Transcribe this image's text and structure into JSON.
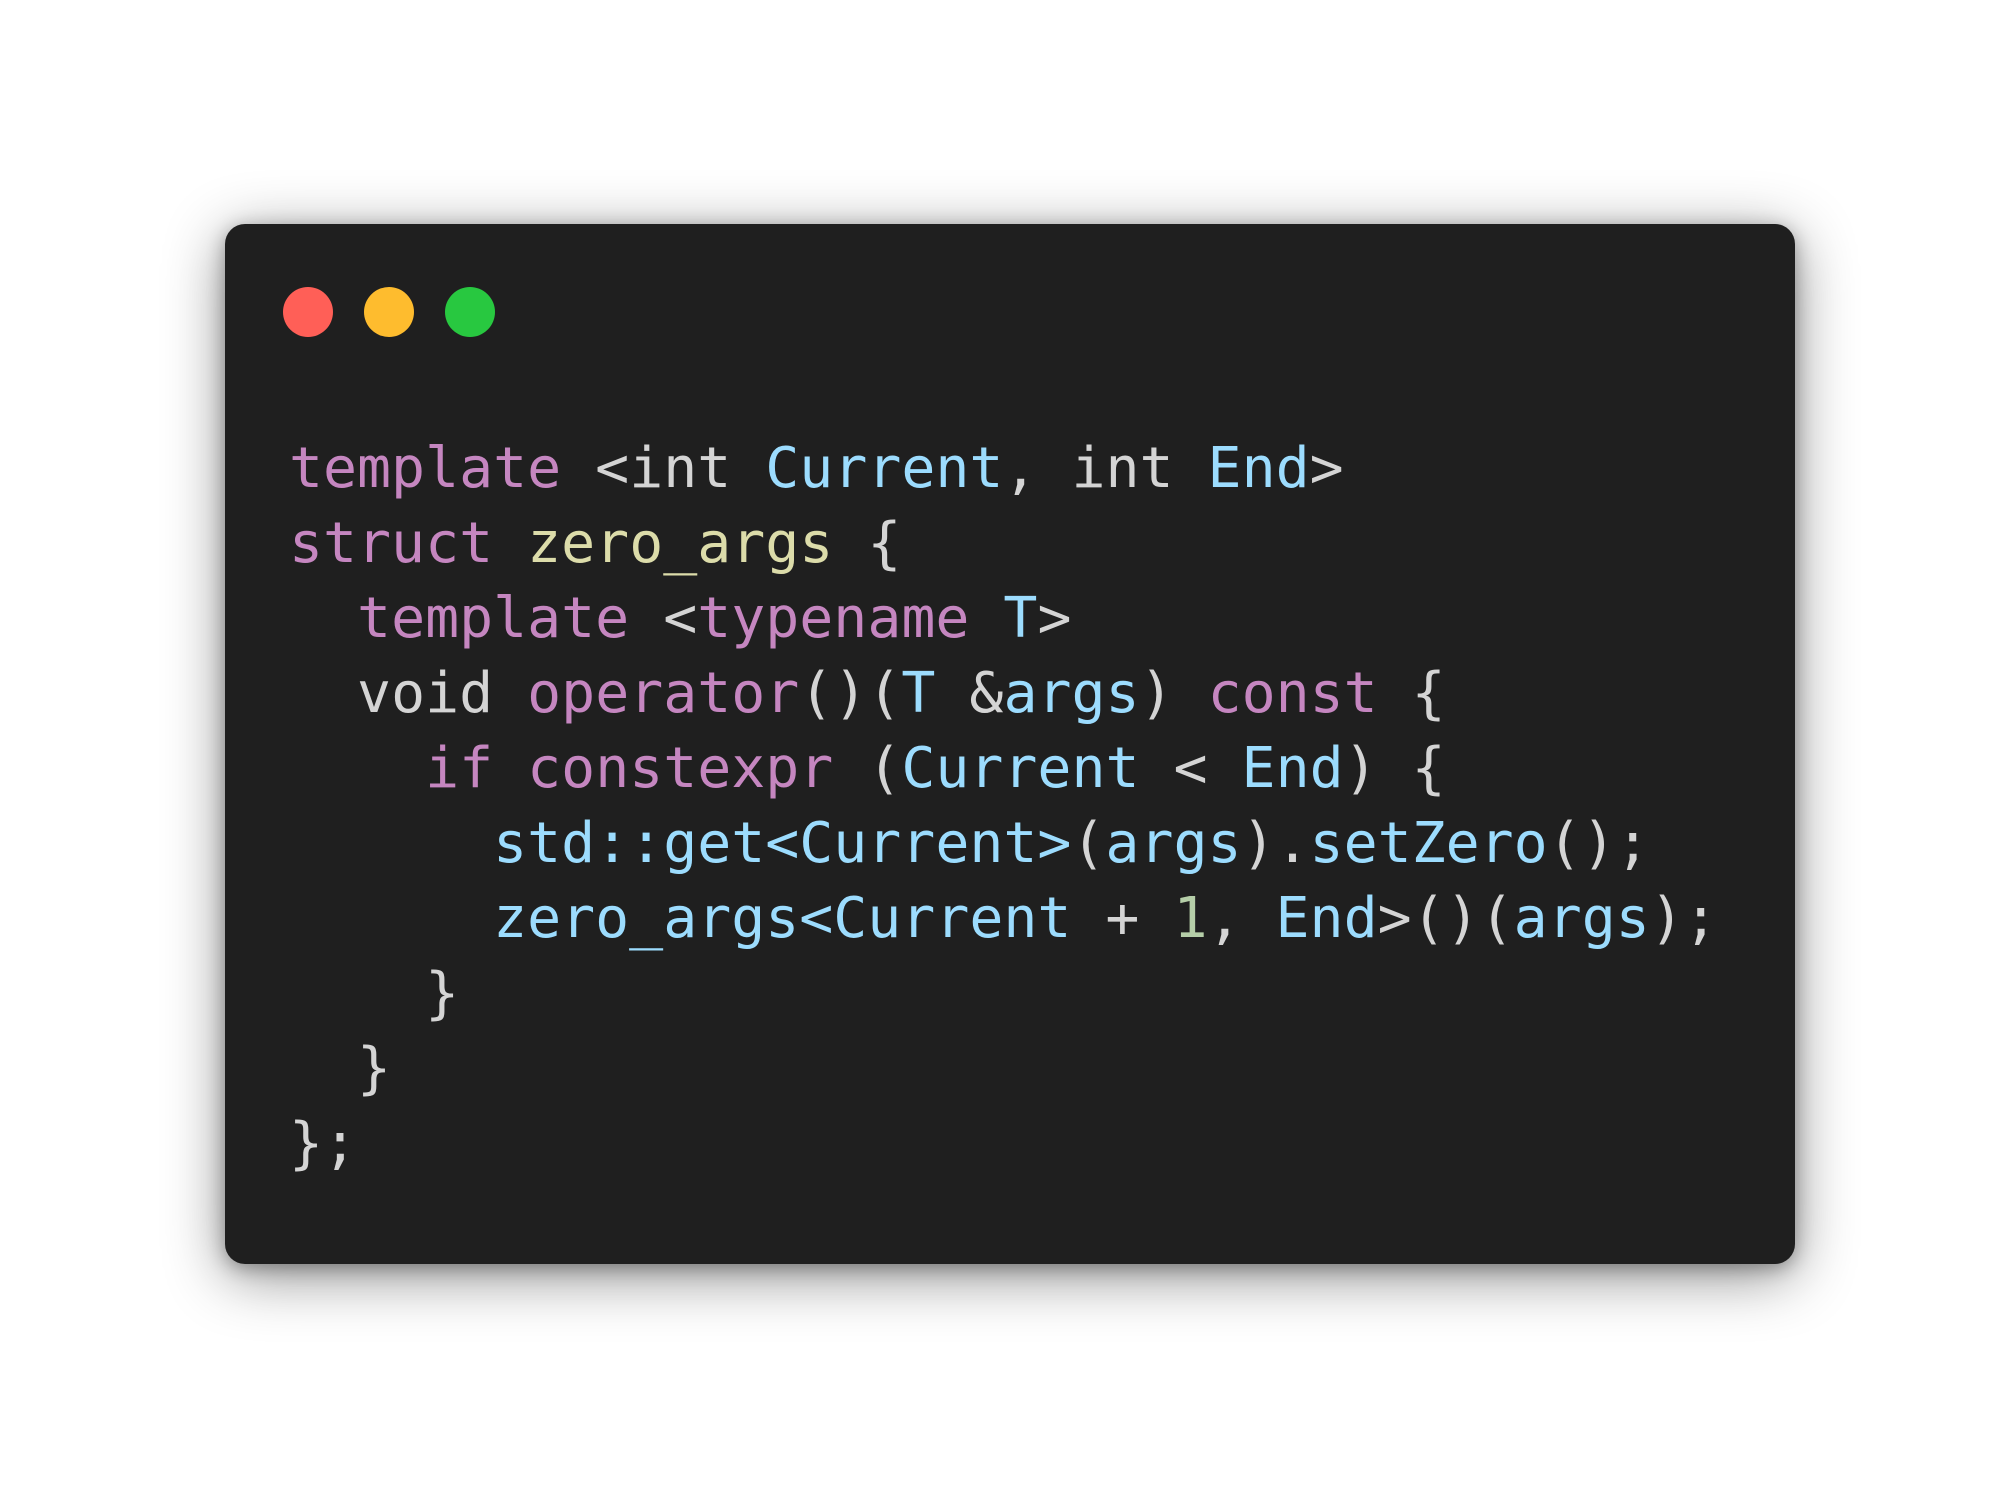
{
  "window": {
    "traffic_lights": [
      {
        "name": "close",
        "color": "#ff5f57"
      },
      {
        "name": "minimize",
        "color": "#febc2e"
      },
      {
        "name": "zoom",
        "color": "#28c840"
      }
    ]
  },
  "code": {
    "colors": {
      "keyword": "#c586c0",
      "type": "#d4d4d4",
      "param": "#9cdcfe",
      "function": "#9cdcfe",
      "identifier": "#dcdcaa",
      "number": "#b5cea8",
      "punctuation": "#d4d4d4",
      "background": "#1f1f1f"
    },
    "lines": [
      [
        {
          "t": "template",
          "c": "keyword"
        },
        {
          "t": " <",
          "c": "punct"
        },
        {
          "t": "int",
          "c": "type"
        },
        {
          "t": " ",
          "c": "punct"
        },
        {
          "t": "Current",
          "c": "param"
        },
        {
          "t": ", ",
          "c": "punct"
        },
        {
          "t": "int",
          "c": "type"
        },
        {
          "t": " ",
          "c": "punct"
        },
        {
          "t": "End",
          "c": "param"
        },
        {
          "t": ">",
          "c": "punct"
        }
      ],
      [
        {
          "t": "struct",
          "c": "keyword"
        },
        {
          "t": " ",
          "c": "punct"
        },
        {
          "t": "zero_args",
          "c": "ident"
        },
        {
          "t": " {",
          "c": "punct"
        }
      ],
      [
        {
          "t": "  ",
          "c": "punct"
        },
        {
          "t": "template",
          "c": "keyword"
        },
        {
          "t": " <",
          "c": "punct"
        },
        {
          "t": "typename",
          "c": "keyword"
        },
        {
          "t": " ",
          "c": "punct"
        },
        {
          "t": "T",
          "c": "param"
        },
        {
          "t": ">",
          "c": "punct"
        }
      ],
      [
        {
          "t": "  ",
          "c": "punct"
        },
        {
          "t": "void",
          "c": "type"
        },
        {
          "t": " ",
          "c": "punct"
        },
        {
          "t": "operator",
          "c": "keyword"
        },
        {
          "t": "()(",
          "c": "punct"
        },
        {
          "t": "T",
          "c": "param"
        },
        {
          "t": " &",
          "c": "punct"
        },
        {
          "t": "args",
          "c": "param"
        },
        {
          "t": ") ",
          "c": "punct"
        },
        {
          "t": "const",
          "c": "keyword"
        },
        {
          "t": " {",
          "c": "punct"
        }
      ],
      [
        {
          "t": "    ",
          "c": "punct"
        },
        {
          "t": "if",
          "c": "keyword"
        },
        {
          "t": " ",
          "c": "punct"
        },
        {
          "t": "constexpr",
          "c": "keyword"
        },
        {
          "t": " (",
          "c": "punct"
        },
        {
          "t": "Current",
          "c": "param"
        },
        {
          "t": " < ",
          "c": "punct"
        },
        {
          "t": "End",
          "c": "param"
        },
        {
          "t": ") {",
          "c": "punct"
        }
      ],
      [
        {
          "t": "      ",
          "c": "punct"
        },
        {
          "t": "std::get<Current>",
          "c": "func"
        },
        {
          "t": "(",
          "c": "punct"
        },
        {
          "t": "args",
          "c": "param"
        },
        {
          "t": ").",
          "c": "punct"
        },
        {
          "t": "setZero",
          "c": "func"
        },
        {
          "t": "();",
          "c": "punct"
        }
      ],
      [
        {
          "t": "      ",
          "c": "punct"
        },
        {
          "t": "zero_args<Current",
          "c": "func"
        },
        {
          "t": " + ",
          "c": "punct"
        },
        {
          "t": "1",
          "c": "number"
        },
        {
          "t": ", ",
          "c": "punct"
        },
        {
          "t": "End",
          "c": "param"
        },
        {
          "t": ">()(",
          "c": "punct"
        },
        {
          "t": "args",
          "c": "param"
        },
        {
          "t": ");",
          "c": "punct"
        }
      ],
      [
        {
          "t": "    }",
          "c": "punct"
        }
      ],
      [
        {
          "t": "  }",
          "c": "punct"
        }
      ],
      [
        {
          "t": "};",
          "c": "punct"
        }
      ]
    ]
  }
}
